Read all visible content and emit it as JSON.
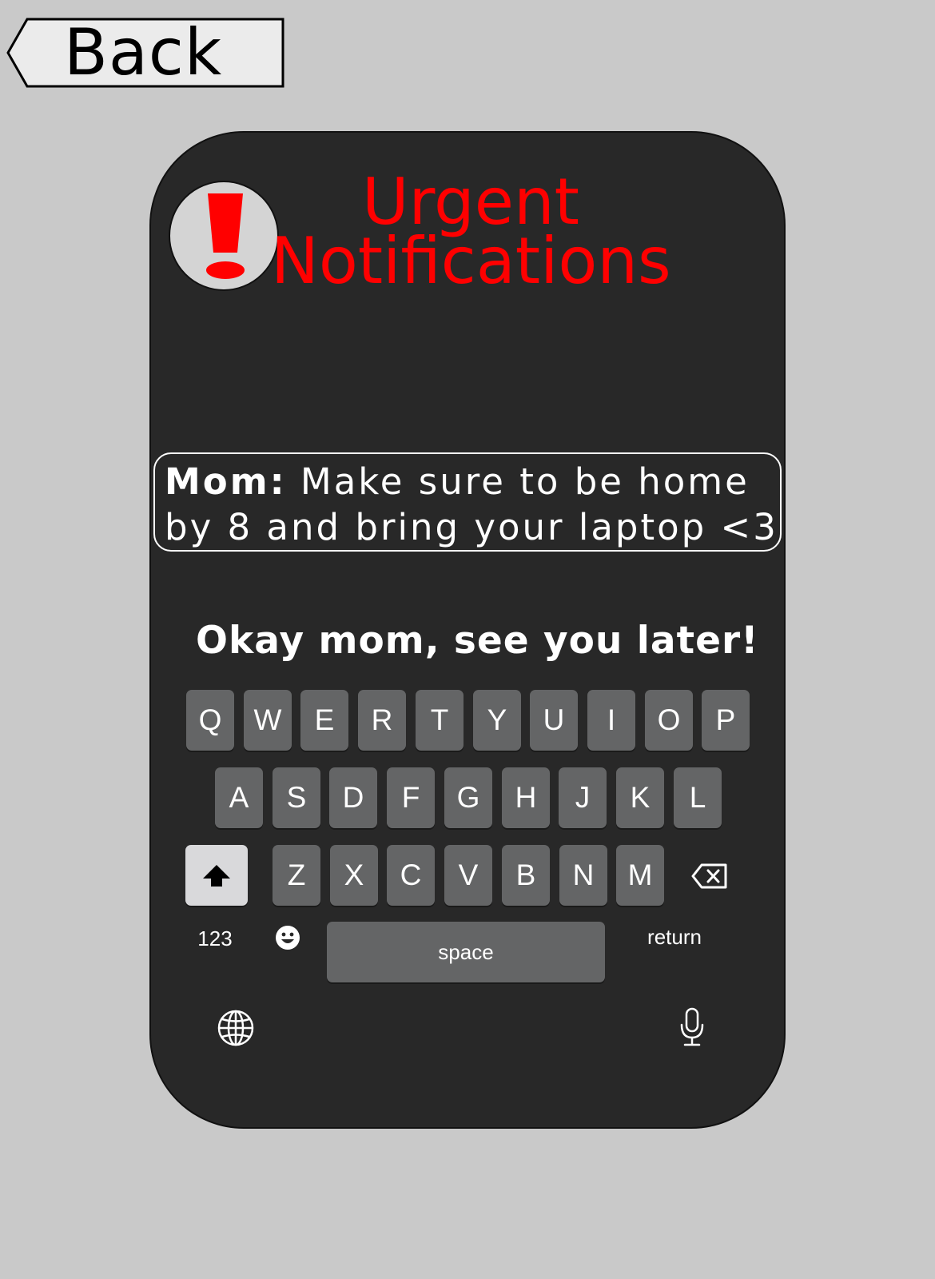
{
  "back_button": {
    "label": "Back"
  },
  "header": {
    "title_line1": "Urgent",
    "title_line2": "Notifications",
    "title_color": "#ff0000",
    "icon": "exclamation-icon"
  },
  "notification": {
    "sender": "Mom:",
    "text": "Make sure to be home by 8 and bring your laptop <3"
  },
  "reply": {
    "text": "Okay mom, see you later!"
  },
  "keyboard": {
    "row1": [
      "Q",
      "W",
      "E",
      "R",
      "T",
      "Y",
      "U",
      "I",
      "O",
      "P"
    ],
    "row2": [
      "A",
      "S",
      "D",
      "F",
      "G",
      "H",
      "J",
      "K",
      "L"
    ],
    "row3": [
      "Z",
      "X",
      "C",
      "V",
      "B",
      "N",
      "M"
    ],
    "numbers_label": "123",
    "space_label": "space",
    "return_label": "return",
    "icons": [
      "shift-icon",
      "backspace-icon",
      "emoji-icon",
      "globe-icon",
      "microphone-icon"
    ]
  },
  "colors": {
    "background": "#c9c9c9",
    "phone": "#282828",
    "key": "#646566",
    "shift_key": "#d9d9db"
  }
}
